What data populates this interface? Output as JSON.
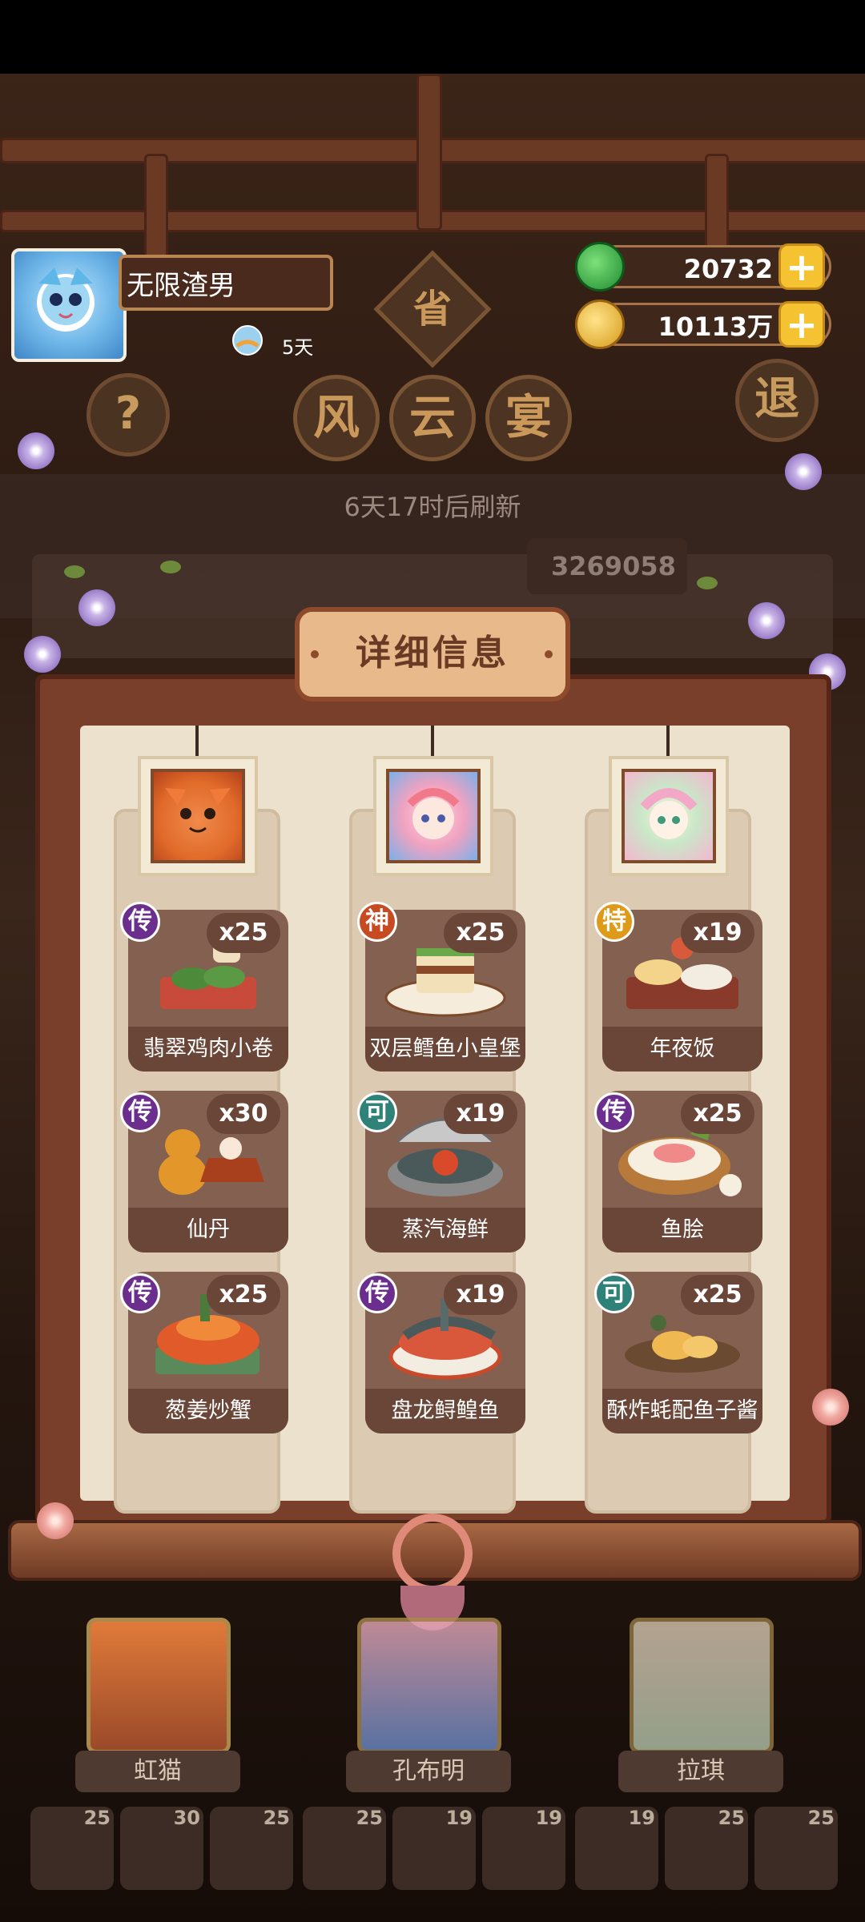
{
  "header": {
    "player_name": "无限渣男",
    "streak_days": "5天",
    "jade_amount": "20732",
    "coin_amount": "10113万",
    "help_label": "?",
    "province_label": "省",
    "title_chars": [
      "风",
      "云",
      "宴"
    ],
    "exit_label": "退",
    "refresh_text": "6天17时后刷新",
    "score_text": "3269058"
  },
  "modal": {
    "title": "详细信息",
    "columns": [
      {
        "chef_icon": "cat-chef-portrait",
        "dishes": [
          {
            "name": "翡翠鸡肉小卷",
            "count": "x25",
            "badge": "传",
            "badge_type": "chuan"
          },
          {
            "name": "仙丹",
            "count": "x30",
            "badge": "传",
            "badge_type": "chuan"
          },
          {
            "name": "葱姜炒蟹",
            "count": "x25",
            "badge": "传",
            "badge_type": "chuan"
          }
        ]
      },
      {
        "chef_icon": "girl-chef-portrait",
        "dishes": [
          {
            "name": "双层鳕鱼小皇堡",
            "count": "x25",
            "badge": "神",
            "badge_type": "shen"
          },
          {
            "name": "蒸汽海鲜",
            "count": "x19",
            "badge": "可",
            "badge_type": "ke"
          },
          {
            "name": "盘龙鲟鳇鱼",
            "count": "x19",
            "badge": "传",
            "badge_type": "chuan"
          }
        ]
      },
      {
        "chef_icon": "pastel-chef-portrait",
        "dishes": [
          {
            "name": "年夜饭",
            "count": "x19",
            "badge": "特",
            "badge_type": "te"
          },
          {
            "name": "鱼脍",
            "count": "x25",
            "badge": "传",
            "badge_type": "chuan"
          },
          {
            "name": "酥炸蚝配鱼子酱",
            "count": "x25",
            "badge": "可",
            "badge_type": "ke"
          }
        ]
      }
    ]
  },
  "bottom": {
    "chefs": [
      "虹猫",
      "孔布明",
      "拉琪"
    ],
    "slots": [
      "25",
      "30",
      "25",
      "25",
      "19",
      "19",
      "19",
      "25",
      "25"
    ]
  },
  "colors": {
    "accent_gold": "#f5c232",
    "panel_brown": "#846050",
    "paper": "#ece1cd"
  }
}
